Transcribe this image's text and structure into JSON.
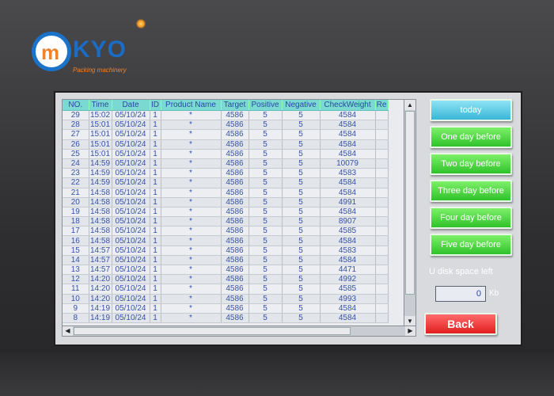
{
  "branding": {
    "logo_letter": "m",
    "logo_text": "KYO",
    "logo_sub": "Packing machinery"
  },
  "table": {
    "columns": [
      "NO.",
      "Time",
      "Date",
      "ID",
      "Product Name",
      "Target",
      "Positive",
      "Negative",
      "CheckWeight",
      "Re"
    ],
    "rows": [
      [
        "29",
        "15:02",
        "05/10/24",
        "1",
        "*",
        "4586",
        "5",
        "5",
        "4584",
        ""
      ],
      [
        "28",
        "15:01",
        "05/10/24",
        "1",
        "*",
        "4586",
        "5",
        "5",
        "4584",
        ""
      ],
      [
        "27",
        "15:01",
        "05/10/24",
        "1",
        "*",
        "4586",
        "5",
        "5",
        "4584",
        ""
      ],
      [
        "26",
        "15:01",
        "05/10/24",
        "1",
        "*",
        "4586",
        "5",
        "5",
        "4584",
        ""
      ],
      [
        "25",
        "15:01",
        "05/10/24",
        "1",
        "*",
        "4586",
        "5",
        "5",
        "4584",
        ""
      ],
      [
        "24",
        "14:59",
        "05/10/24",
        "1",
        "*",
        "4586",
        "5",
        "5",
        "10079",
        ""
      ],
      [
        "23",
        "14:59",
        "05/10/24",
        "1",
        "*",
        "4586",
        "5",
        "5",
        "4583",
        ""
      ],
      [
        "22",
        "14:59",
        "05/10/24",
        "1",
        "*",
        "4586",
        "5",
        "5",
        "4584",
        ""
      ],
      [
        "21",
        "14:58",
        "05/10/24",
        "1",
        "*",
        "4586",
        "5",
        "5",
        "4584",
        ""
      ],
      [
        "20",
        "14:58",
        "05/10/24",
        "1",
        "*",
        "4586",
        "5",
        "5",
        "4991",
        ""
      ],
      [
        "19",
        "14:58",
        "05/10/24",
        "1",
        "*",
        "4586",
        "5",
        "5",
        "4584",
        ""
      ],
      [
        "18",
        "14:58",
        "05/10/24",
        "1",
        "*",
        "4586",
        "5",
        "5",
        "8907",
        ""
      ],
      [
        "17",
        "14:58",
        "05/10/24",
        "1",
        "*",
        "4586",
        "5",
        "5",
        "4585",
        ""
      ],
      [
        "16",
        "14:58",
        "05/10/24",
        "1",
        "*",
        "4586",
        "5",
        "5",
        "4584",
        ""
      ],
      [
        "15",
        "14:57",
        "05/10/24",
        "1",
        "*",
        "4586",
        "5",
        "5",
        "4583",
        ""
      ],
      [
        "14",
        "14:57",
        "05/10/24",
        "1",
        "*",
        "4586",
        "5",
        "5",
        "4584",
        ""
      ],
      [
        "13",
        "14:57",
        "05/10/24",
        "1",
        "*",
        "4586",
        "5",
        "5",
        "4471",
        ""
      ],
      [
        "12",
        "14:20",
        "05/10/24",
        "1",
        "*",
        "4586",
        "5",
        "5",
        "4992",
        ""
      ],
      [
        "11",
        "14:20",
        "05/10/24",
        "1",
        "*",
        "4586",
        "5",
        "5",
        "4585",
        ""
      ],
      [
        "10",
        "14:20",
        "05/10/24",
        "1",
        "*",
        "4586",
        "5",
        "5",
        "4993",
        ""
      ],
      [
        "9",
        "14:19",
        "05/10/24",
        "1",
        "*",
        "4586",
        "5",
        "5",
        "4584",
        ""
      ],
      [
        "8",
        "14:19",
        "05/10/24",
        "1",
        "*",
        "4586",
        "5",
        "5",
        "4584",
        ""
      ]
    ]
  },
  "buttons": {
    "today": "today",
    "one_day": "One day before",
    "two_day": "Two day before",
    "three_day": "Three day before",
    "four_day": "Four day before",
    "five_day": "Five day before",
    "back": "Back"
  },
  "disk": {
    "label": "U disk space left",
    "value": "0",
    "unit": "Kb"
  },
  "icons": {
    "scroll_up": "arrow-up-icon",
    "scroll_down": "arrow-down-icon",
    "scroll_left": "arrow-left-icon",
    "scroll_right": "arrow-right-icon"
  },
  "colors": {
    "header_bg": "#7ad9d0",
    "button_green": "#2fc22a",
    "button_cyan": "#3ab6d8",
    "button_red": "#e21e1e",
    "logo_blue": "#1a6cc4",
    "logo_orange": "#f0822a"
  }
}
